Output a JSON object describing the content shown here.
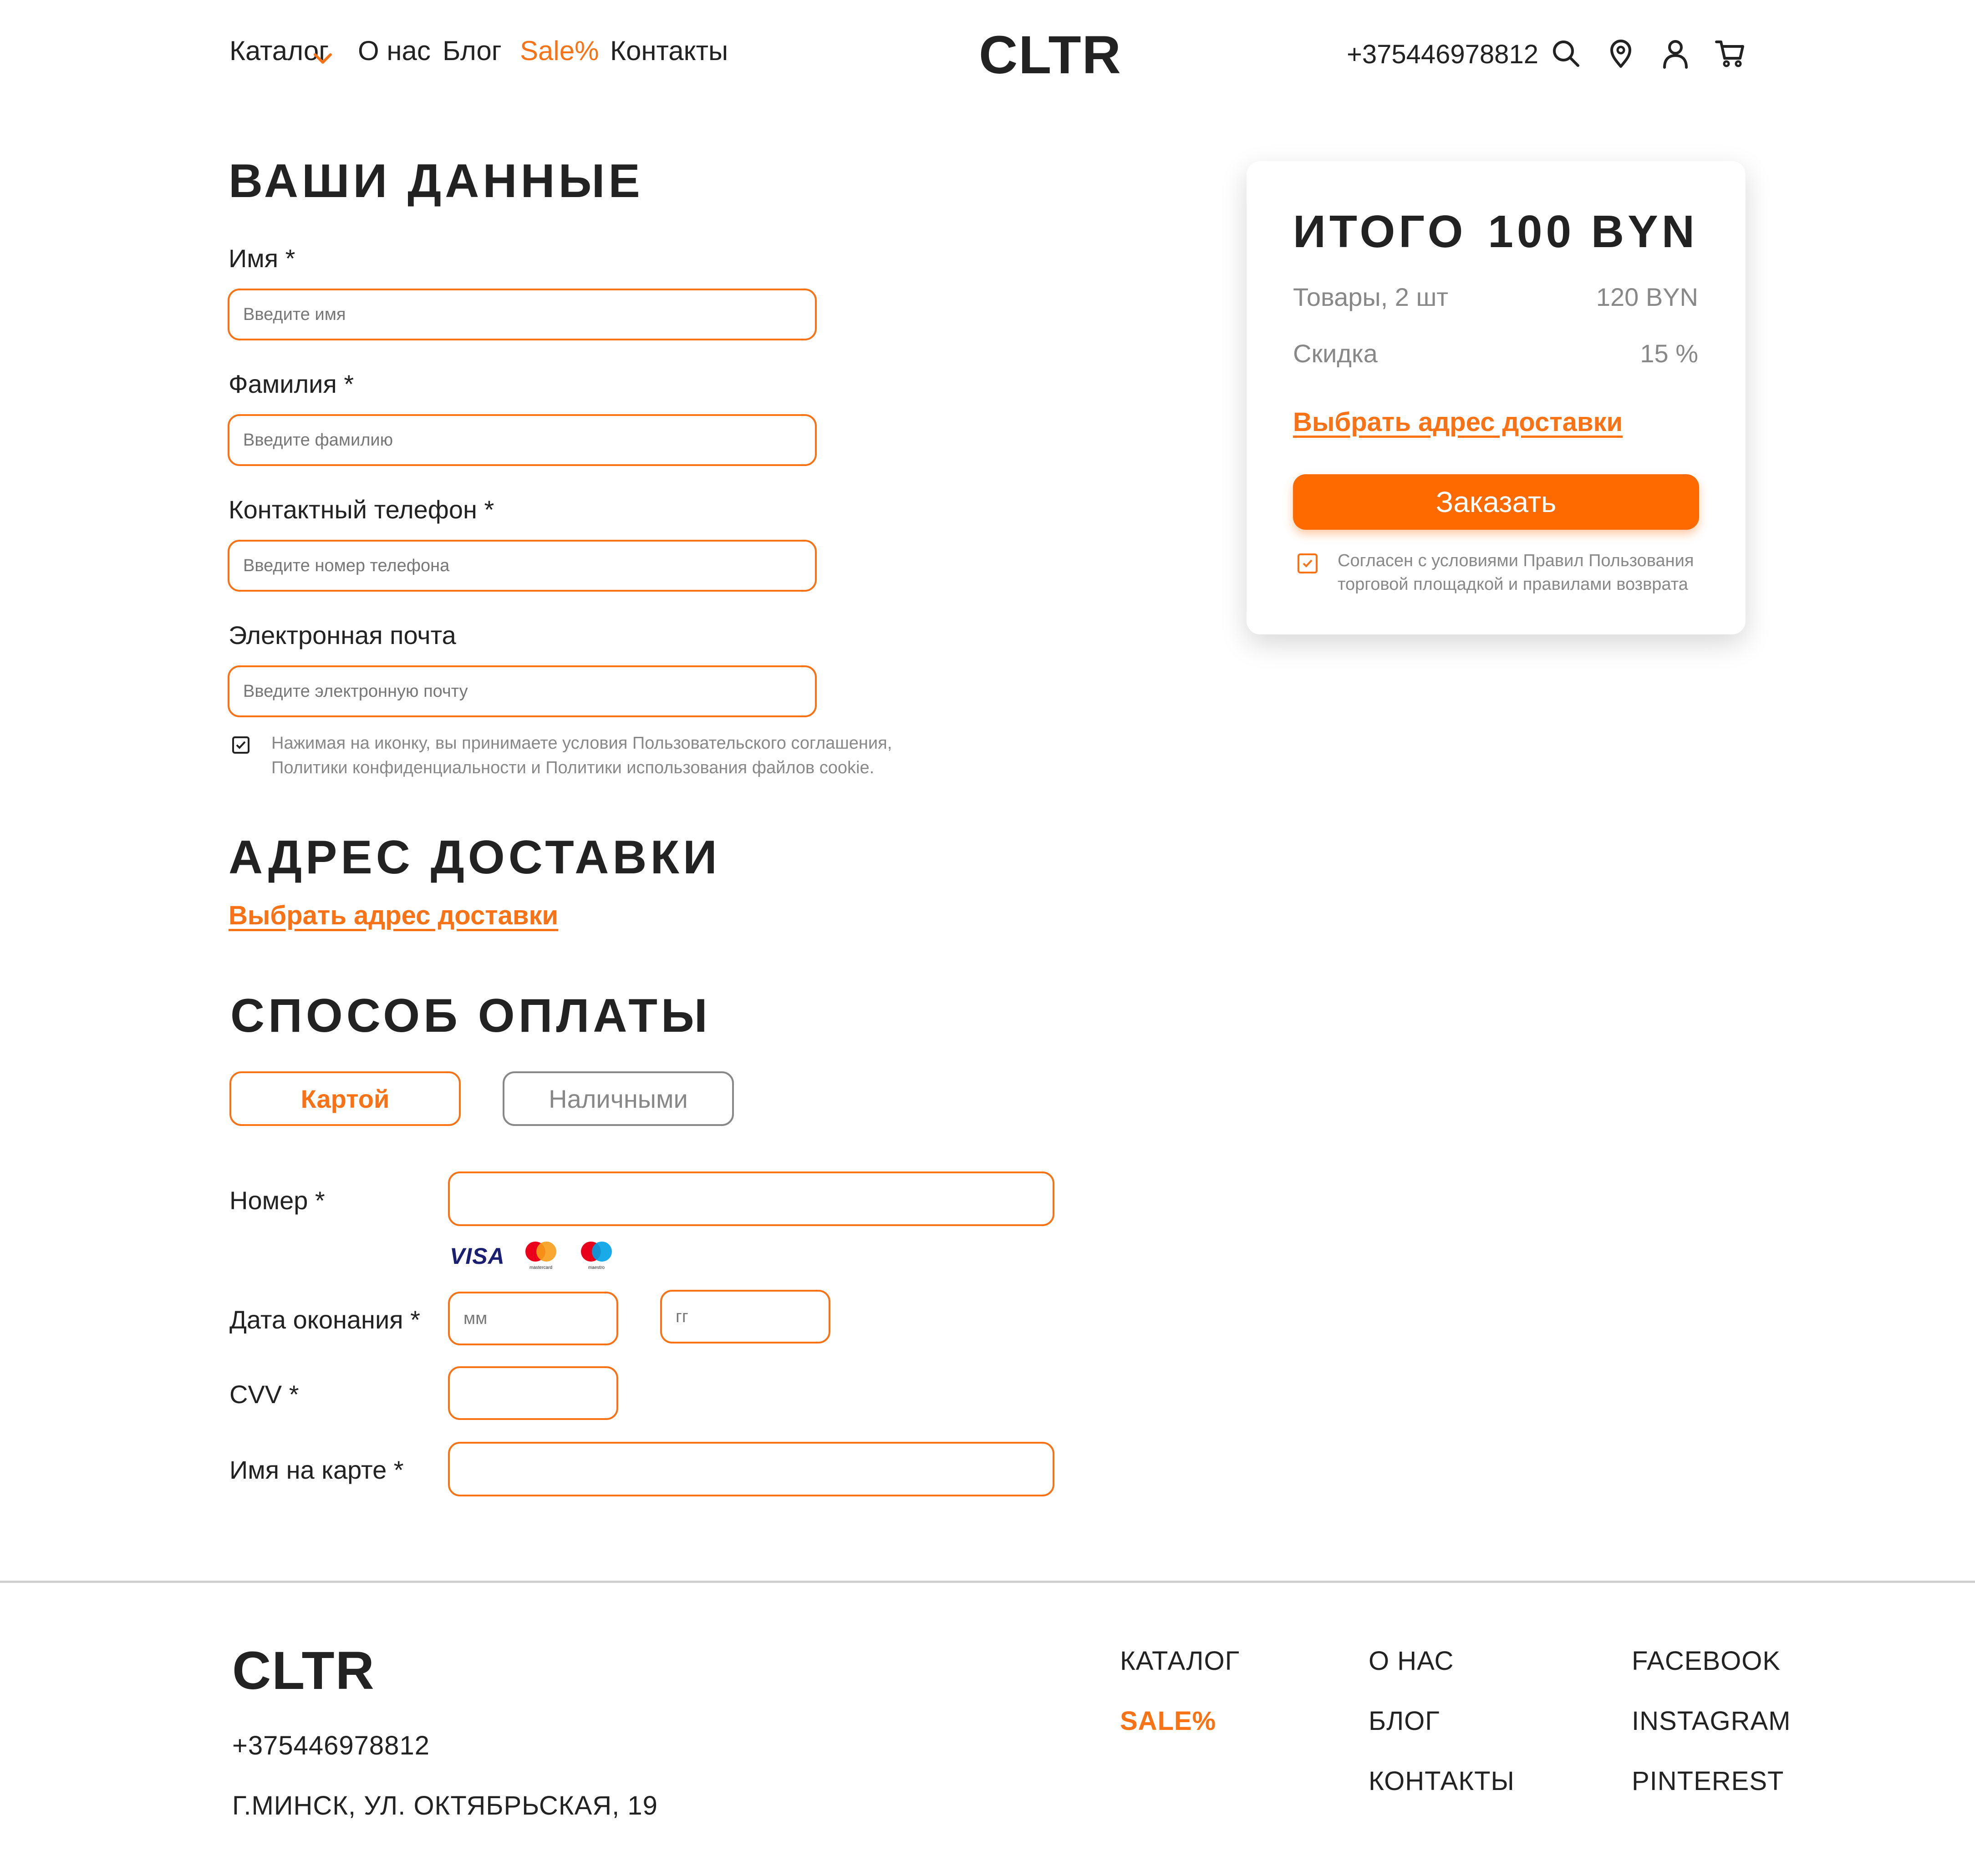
{
  "header": {
    "nav": [
      {
        "label": "Каталог"
      },
      {
        "label": "О нас"
      },
      {
        "label": "Блог"
      },
      {
        "label": "Sale%"
      },
      {
        "label": "Контакты"
      }
    ],
    "logo": "CLTR",
    "phone": "+375446978812",
    "icons": [
      "search-icon",
      "location-pin-icon",
      "user-icon",
      "cart-icon"
    ]
  },
  "personal": {
    "title": "ВАШИ ДАННЫЕ",
    "fields": [
      {
        "label": "Имя *",
        "placeholder": "Введите имя"
      },
      {
        "label": "Фамилия *",
        "placeholder": "Введите фамилию"
      },
      {
        "label": "Контактный телефон *",
        "placeholder": "Введите номер телефона"
      },
      {
        "label": "Электронная почта",
        "placeholder": "Введите электронную почту"
      }
    ],
    "consent_line1": "Нажимая на иконку, вы принимаете условия Пользовательского соглашения,",
    "consent_line2": "Политики конфиденциальности и Политики использования файлов cookie.",
    "consent_checked": true
  },
  "delivery": {
    "title": "АДРЕС ДОСТАВКИ",
    "link": "Выбрать адрес доставки"
  },
  "payment": {
    "title": "СПОСОБ ОПЛАТЫ",
    "methods": [
      {
        "label": "Картой",
        "selected": true
      },
      {
        "label": "Наличными",
        "selected": false
      }
    ],
    "number_label": "Номер *",
    "expiry_label": "Дата оконания *",
    "month_placeholder": "мм",
    "year_placeholder": "гг",
    "cvv_label": "CVV *",
    "name_label": "Имя на карте *",
    "card_brands": [
      "visa",
      "mastercard",
      "maestro"
    ],
    "mastercard_text": "mastercard",
    "maestro_text": "maestro",
    "visa_text": "VISA"
  },
  "summary": {
    "total_label": "ИТОГО",
    "total_value": "100 BYN",
    "items_label": "Товары, 2 шт",
    "items_value": "120 BYN",
    "discount_label": "Скидка",
    "discount_value": "15 %",
    "delivery_link": "Выбрать адрес доставки",
    "order_button": "Заказать",
    "agree_line1": "Согласен с условиями Правил Пользования",
    "agree_line2": "торговой площадкой и правилами возврата",
    "agree_checked": true
  },
  "footer": {
    "logo": "CLTR",
    "phone": "+375446978812",
    "address": "Г.МИНСК, УЛ. ОКТЯБРЬСКАЯ, 19",
    "col1": [
      "КАТАЛОГ",
      "SALE%"
    ],
    "col2": [
      "О НАС",
      "БЛОГ",
      "КОНТАКТЫ"
    ],
    "col3": [
      "FACEBOOK",
      "INSTAGRAM",
      "PINTEREST"
    ]
  },
  "colors": {
    "accent": "#f97316",
    "button": "#ff6a00",
    "text": "#222222",
    "muted": "#888888"
  }
}
